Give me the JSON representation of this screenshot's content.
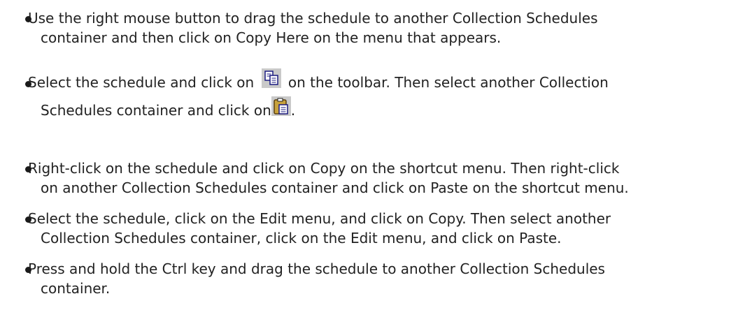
{
  "items": [
    {
      "lines": [
        "Use the right mouse button to drag the schedule to another Collection Schedules",
        "container and then click on Copy Here on the menu that appears."
      ]
    },
    {
      "line1_before": "Select the schedule and click on",
      "copy_icon": "copy-icon",
      "line1_after": "on the toolbar. Then select another Collection",
      "line2_before": "Schedules container and click on",
      "paste_icon": "paste-icon",
      "line2_after": "."
    },
    {
      "lines": [
        "Right-click on the schedule and click on Copy on the shortcut menu. Then right-click",
        "on another Collection Schedules container and click on Paste on the shortcut menu."
      ]
    },
    {
      "lines": [
        "Select the schedule, click on the Edit menu, and click on Copy. Then select another",
        "Collection Schedules container, click on the Edit menu, and click on Paste."
      ]
    },
    {
      "lines": [
        "Press and hold the Ctrl key and drag the schedule to another Collection Schedules",
        "container."
      ]
    }
  ]
}
